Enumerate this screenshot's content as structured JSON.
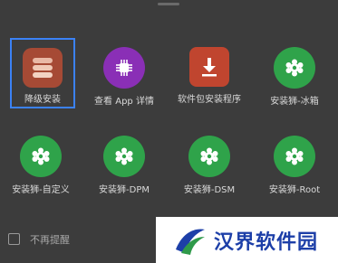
{
  "sheet": {
    "apps": [
      {
        "label": "降级安装",
        "icon": "layers-stack-icon",
        "selected": true
      },
      {
        "label": "查看 App 详情",
        "icon": "chip-icon"
      },
      {
        "label": "软件包安装程序",
        "icon": "download-icon"
      },
      {
        "label": "安装狮-冰箱",
        "icon": "gear-flower-icon"
      },
      {
        "label": "安装狮-自定义",
        "icon": "gear-flower-icon"
      },
      {
        "label": "安装狮-DPM",
        "icon": "gear-flower-icon"
      },
      {
        "label": "安装狮-DSM",
        "icon": "gear-flower-icon"
      },
      {
        "label": "安装狮-Root",
        "icon": "gear-flower-icon"
      }
    ],
    "footer": {
      "dont_remind_label": "不再提醒",
      "dont_remind_checked": false
    }
  },
  "watermark": {
    "text": "汉界软件园"
  },
  "colors": {
    "background": "#3c3c3c",
    "selection_border": "#3b82f6",
    "installer_green": "#2fa34a",
    "details_purple": "#8a2fb6",
    "package_red": "#c0452f"
  }
}
